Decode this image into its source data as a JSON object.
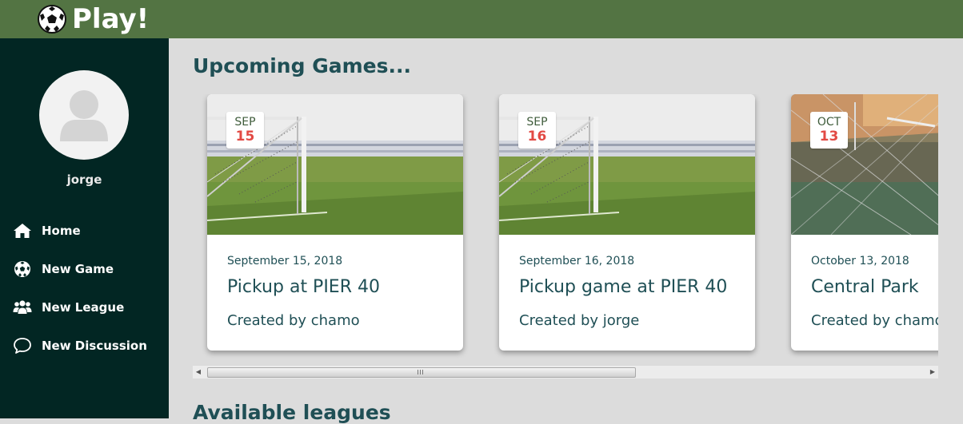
{
  "app": {
    "title": "Play!",
    "logo_icon": "soccer-ball-icon"
  },
  "theme": {
    "topbar": "#537443",
    "sidebar": "#022623",
    "text": "#1f4f55",
    "badge_day": "#e24a44",
    "badge_month": "#3f5c3b"
  },
  "sidebar": {
    "username": "jorge",
    "items": [
      {
        "label": "Home",
        "icon": "home-icon"
      },
      {
        "label": "New Game",
        "icon": "soccer-ball-icon"
      },
      {
        "label": "New League",
        "icon": "users-icon"
      },
      {
        "label": "New Discussion",
        "icon": "speech-bubble-icon"
      }
    ]
  },
  "main": {
    "upcoming_title": "Upcoming Games...",
    "leagues_title": "Available leagues",
    "cards": [
      {
        "month": "SEP",
        "day": "15",
        "date": "September 15, 2018",
        "title": "Pickup at PIER 40",
        "creator": "Created by chamo"
      },
      {
        "month": "SEP",
        "day": "16",
        "date": "September 16, 2018",
        "title": "Pickup game at PIER 40",
        "creator": "Created by jorge"
      },
      {
        "month": "OCT",
        "day": "13",
        "date": "October 13, 2018",
        "title": "Central Park",
        "creator": "Created by chamo"
      }
    ]
  }
}
